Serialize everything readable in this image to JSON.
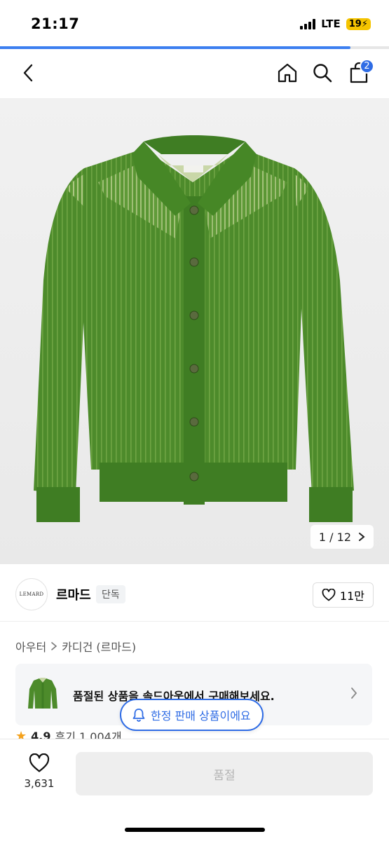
{
  "status_bar": {
    "time": "21:17",
    "network": "LTE",
    "battery": "19"
  },
  "page_load_progress": 0.9,
  "header": {
    "cart_count": "2"
  },
  "hero": {
    "image_counter": "1 / 12"
  },
  "brand": {
    "logo_text": "LEMARD",
    "name": "르마드",
    "tag": "단독",
    "likes": "11만"
  },
  "breadcrumb": {
    "items": [
      "아우터",
      "카디건 (르마드)"
    ]
  },
  "soldout_banner": {
    "text": "품절된 상품을 솔드아웃에서 구매해보세요."
  },
  "limited_pill": {
    "text": "한정 판매 상품이에요"
  },
  "rating": {
    "score": "4.9",
    "reviews": "후기 1,004개"
  },
  "bottom": {
    "wish_count": "3,631",
    "button_label": "품절"
  },
  "colors": {
    "accent": "#2f6ce5",
    "cardigan_green": "#4b8a2a",
    "battery": "#f5c400"
  }
}
